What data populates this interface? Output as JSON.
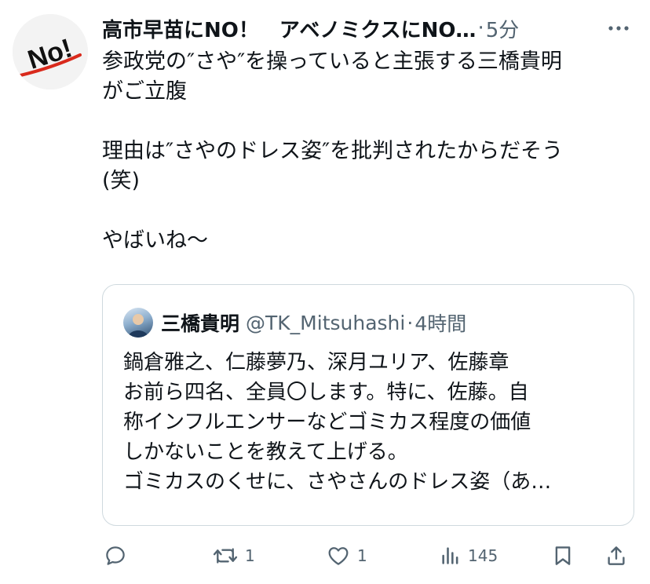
{
  "post": {
    "author": "高市早苗にNO！　アベノミクスにNO…",
    "dot": "·",
    "time": "5分",
    "avatar_text": "No!",
    "body": "参政党の″さや″を操っていると主張する三橋貴明\nがご立腹\n\n理由は″さやのドレス姿″を批判されたからだそう\n(笑)\n\nやばいね～"
  },
  "quote": {
    "name": "三橋貴明",
    "handle": "@TK_Mitsuhashi",
    "dot": "·",
    "time": "4時間",
    "text": "鍋倉雅之、仁藤夢乃、深月ユリア、佐藤章\nお前ら四名、全員〇します。特に、佐藤。自\n称インフルエンサーなどゴミカス程度の価値\nしかないことを教えて上げる。\nゴミカスのくせに、さやさんのドレス姿（あ…"
  },
  "actions": {
    "reply_count": "",
    "repost_count": "1",
    "like_count": "1",
    "views_count": "145"
  },
  "icons": {
    "more": "more-icon",
    "reply": "reply-icon",
    "repost": "repost-icon",
    "like": "heart-icon",
    "views": "views-icon",
    "bookmark": "bookmark-icon",
    "share": "share-icon"
  },
  "colors": {
    "text": "#0f1419",
    "secondary": "#536471",
    "border": "#cfd9de",
    "logo_red": "#d92a1c"
  }
}
